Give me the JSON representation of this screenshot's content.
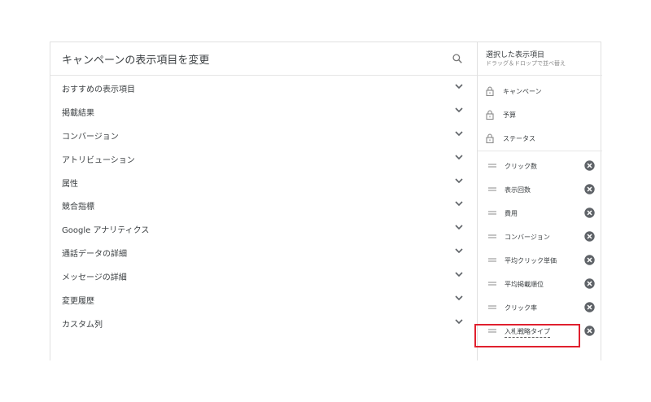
{
  "header": {
    "title": "キャンペーンの表示項目を変更"
  },
  "icons": {
    "search": "search-icon",
    "chevron": "chevron-down-icon",
    "lock": "lock-icon",
    "drag": "drag-handle-icon",
    "remove": "remove-circle-icon"
  },
  "categories": [
    "おすすめの表示項目",
    "掲載結果",
    "コンバージョン",
    "アトリビューション",
    "属性",
    "競合指標",
    "Google アナリティクス",
    "通話データの詳細",
    "メッセージの詳細",
    "変更履歴",
    "カスタム列"
  ],
  "selected": {
    "title": "選択した表示項目",
    "subtitle": "ドラッグ＆ドロップで並べ替え",
    "locked": [
      "キャンペーン",
      "予算",
      "ステータス"
    ],
    "items": [
      "クリック数",
      "表示回数",
      "費用",
      "コンバージョン",
      "平均クリック単価",
      "平均掲載順位",
      "クリック率",
      "入札戦略タイプ"
    ]
  },
  "colors": {
    "highlight": "#e0202e",
    "icon": "#757575"
  }
}
